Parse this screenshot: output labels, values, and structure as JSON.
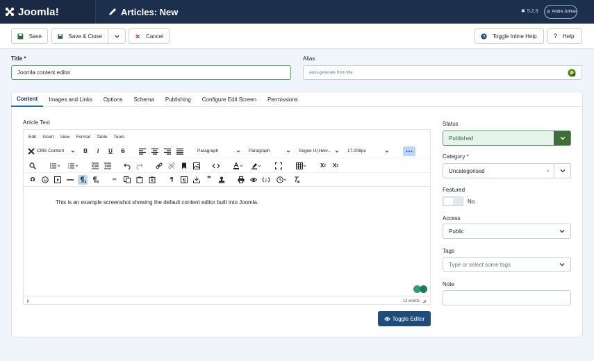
{
  "app": {
    "brand": "Joomla!",
    "page_title": "Articles: New",
    "version": "5.2.3",
    "user": "Andre Juttras"
  },
  "toolbar": {
    "save": "Save",
    "save_close": "Save & Close",
    "cancel": "Cancel",
    "toggle_inline_help": "Toggle Inline Help",
    "help": "Help"
  },
  "form": {
    "title_label": "Title *",
    "title_value": "Joomla content editor",
    "alias_label": "Alias",
    "alias_placeholder": "Auto-generate from title"
  },
  "tabs": [
    "Content",
    "Images and Links",
    "Options",
    "Schema",
    "Publishing",
    "Configure Edit Screen",
    "Permissions"
  ],
  "editor": {
    "label": "Article Text",
    "menu": [
      "Edit",
      "Insert",
      "View",
      "Format",
      "Table",
      "Tools"
    ],
    "cms_content": "CMS Content",
    "block_format_1": "Paragraph",
    "block_format_2": "Paragraph",
    "font_family": "Segoe UI,Helv...",
    "font_size": "17.008px",
    "content": "This is an example screenshot showing the default content editor built into Joomla.",
    "path": "p",
    "word_count": "13 words",
    "toggle_button": "Toggle Editor"
  },
  "sidebar": {
    "status_label": "Status",
    "status_value": "Published",
    "category_label": "Category *",
    "category_value": "Uncategorised",
    "featured_label": "Featured",
    "featured_value": "No",
    "access_label": "Access",
    "access_value": "Public",
    "tags_label": "Tags",
    "tags_placeholder": "Type or select some tags",
    "note_label": "Note"
  },
  "colors": {
    "header": "#1c2f4c",
    "accent": "#2a69b8",
    "status_green": "#3f6d3a",
    "toggle_editor": "#1f4d7a"
  }
}
